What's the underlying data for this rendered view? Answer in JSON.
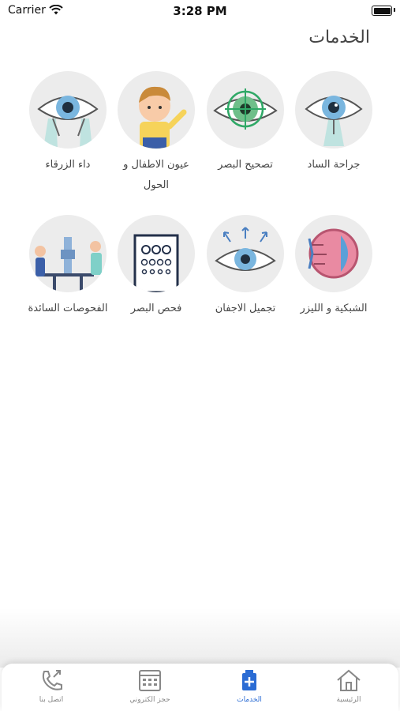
{
  "status_bar": {
    "carrier": "Carrier",
    "time": "3:28 PM"
  },
  "header": {
    "title": "الخدمات"
  },
  "services": [
    {
      "label": "جراحة الساد",
      "icon": "cataract-surgery-icon"
    },
    {
      "label": "تصحيح البصر",
      "icon": "vision-correction-icon"
    },
    {
      "label": "عيون الاطفال و الحول",
      "icon": "pediatric-eyes-icon"
    },
    {
      "label": "داء الزرقاء",
      "icon": "glaucoma-icon"
    },
    {
      "label": "الشبكية و الليزر",
      "icon": "retina-laser-icon"
    },
    {
      "label": "تجميل الاجفان",
      "icon": "eyelid-cosmetic-icon"
    },
    {
      "label": "فحص البصر",
      "icon": "eye-chart-icon"
    },
    {
      "label": "الفحوصات السائدة",
      "icon": "eye-exam-icon"
    }
  ],
  "tabbar": {
    "items": [
      {
        "label": "الرئيسية",
        "icon": "home-icon"
      },
      {
        "label": "الخدمات",
        "icon": "medical-kit-icon",
        "active": true
      },
      {
        "label": "حجز الكتروني",
        "icon": "calendar-icon"
      },
      {
        "label": "اتصل بنا",
        "icon": "phone-icon"
      }
    ]
  },
  "colors": {
    "accent": "#2b6cd4",
    "circle_bg": "#ececec"
  }
}
